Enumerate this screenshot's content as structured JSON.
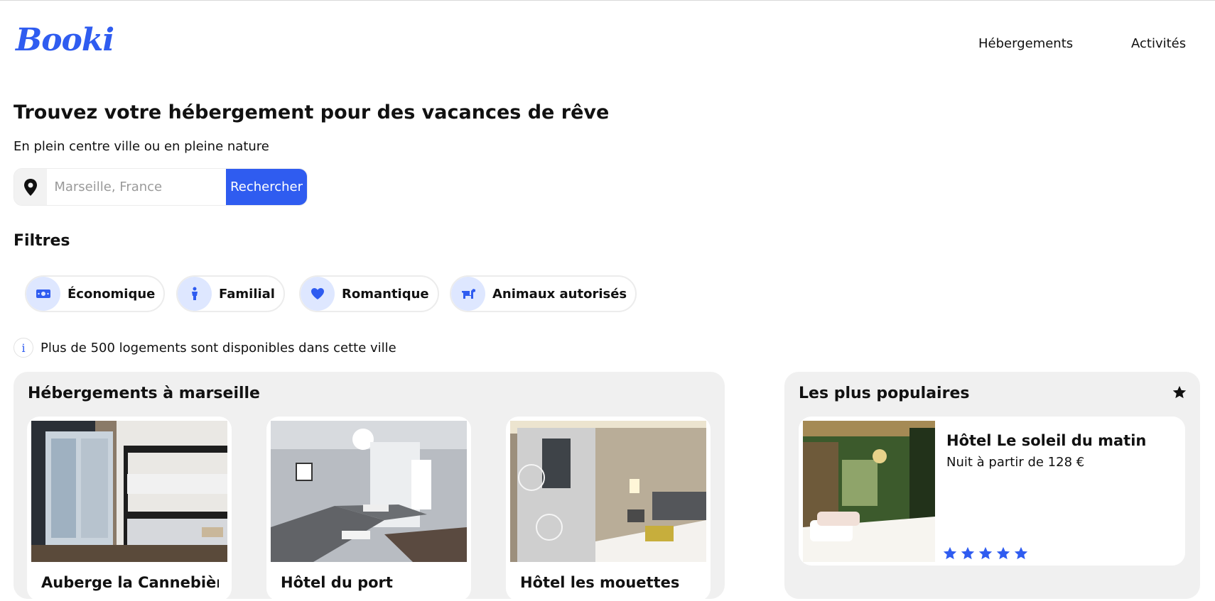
{
  "brand": {
    "logo_text": "Booki",
    "accent": "#2f5cf0"
  },
  "nav": {
    "items": [
      {
        "label": "Hébergements"
      },
      {
        "label": "Activités"
      }
    ]
  },
  "hero": {
    "title": "Trouvez votre hébergement pour des vacances de rêve",
    "subtitle": "En plein centre ville ou en pleine nature"
  },
  "search": {
    "placeholder": "Marseille, France",
    "value": "",
    "button_label": "Rechercher",
    "icon": "location-pin-icon"
  },
  "filters": {
    "title": "Filtres",
    "items": [
      {
        "label": "Économique",
        "icon": "money-icon"
      },
      {
        "label": "Familial",
        "icon": "person-icon"
      },
      {
        "label": "Romantique",
        "icon": "heart-icon"
      },
      {
        "label": "Animaux autorisés",
        "icon": "dog-icon"
      }
    ]
  },
  "info": {
    "icon": "info-icon",
    "text": "Plus de 500 logements sont disponibles dans cette ville"
  },
  "accommodations": {
    "title": "Hébergements à marseille",
    "cards": [
      {
        "title": "Auberge la Cannebière"
      },
      {
        "title": "Hôtel du port"
      },
      {
        "title": "Hôtel les mouettes"
      }
    ]
  },
  "popular": {
    "title": "Les plus populaires",
    "icon": "star-icon",
    "items": [
      {
        "title": "Hôtel Le soleil du matin",
        "price": "Nuit à partir de 128 €",
        "rating": 5
      }
    ]
  }
}
